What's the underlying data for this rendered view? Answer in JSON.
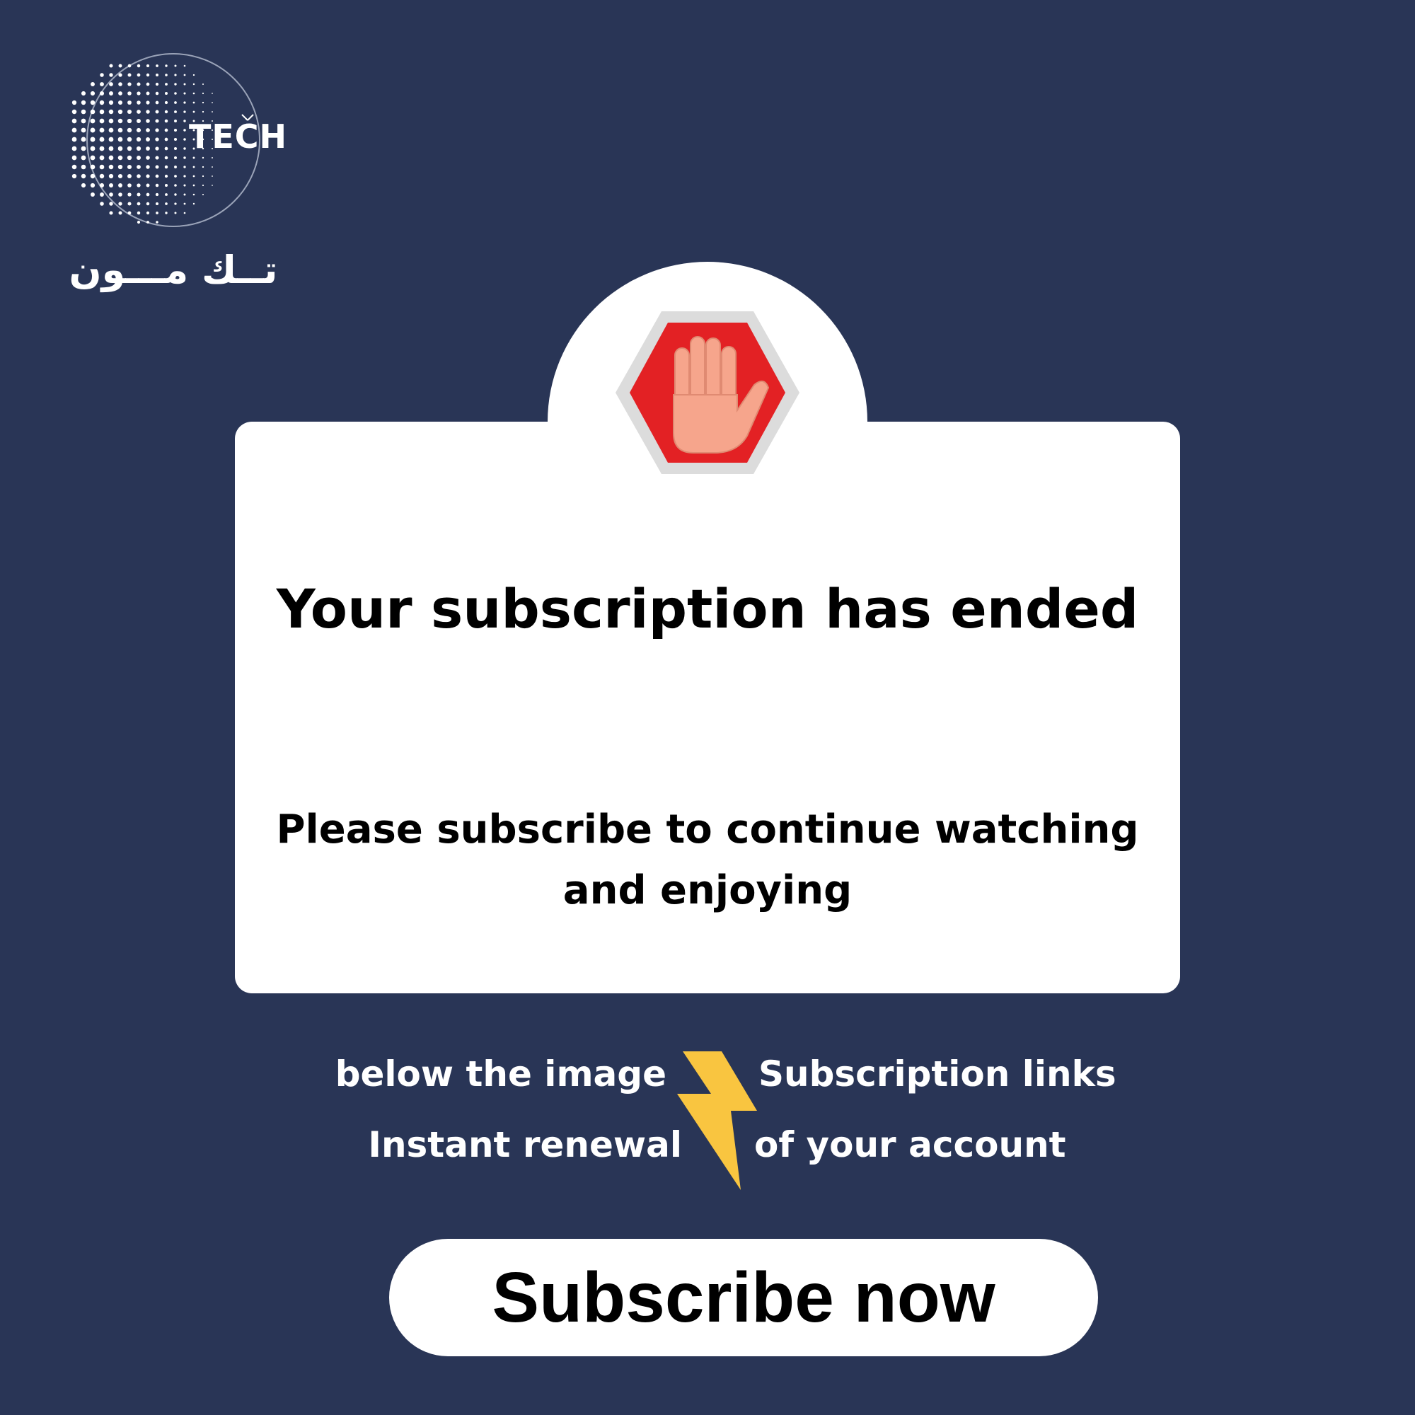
{
  "brand": {
    "logo_text": "TECH",
    "arabic_name": "تــك مـــون"
  },
  "notice": {
    "icon": "stop-hand-icon",
    "title": "Your subscription has ended",
    "subtitle": "Please subscribe to continue watching and enjoying"
  },
  "info": {
    "left_line_1": "below the image",
    "left_line_2": "Instant renewal",
    "right_line_1": "Subscription links",
    "right_line_2": "of your account",
    "icon": "lightning-bolt-icon"
  },
  "cta": {
    "label": "Subscribe now"
  },
  "colors": {
    "background": "#293556",
    "card": "#ffffff",
    "stop_red": "#e32124",
    "hand": "#f6a58c",
    "bolt": "#f9c540"
  }
}
